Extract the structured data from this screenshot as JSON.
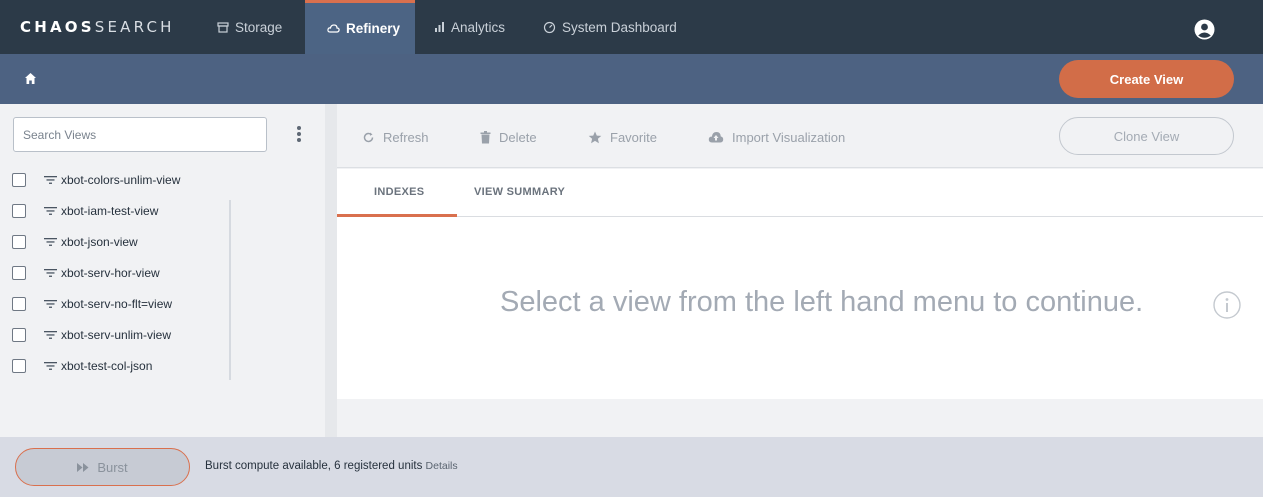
{
  "app": {
    "logo_bold": "CHAOS",
    "logo_light": "SEARCH"
  },
  "nav": {
    "tabs": [
      {
        "label": "Storage",
        "icon": "storage-icon"
      },
      {
        "label": "Refinery",
        "icon": "refinery-icon",
        "active": true
      },
      {
        "label": "Analytics",
        "icon": "analytics-icon"
      },
      {
        "label": "System Dashboard",
        "icon": "dashboard-icon"
      }
    ],
    "user_icon": "user-circle-icon"
  },
  "subbar": {
    "home_icon": "home-icon",
    "create_label": "Create View"
  },
  "sidebar": {
    "search_placeholder": "Search Views",
    "views": [
      "xbot-colors-unlim-view",
      "xbot-iam-test-view",
      "xbot-json-view",
      "xbot-serv-hor-view",
      "xbot-serv-no-flt=view",
      "xbot-serv-unlim-view",
      "xbot-test-col-json"
    ]
  },
  "toolbar": {
    "refresh": "Refresh",
    "delete": "Delete",
    "favorite": "Favorite",
    "import": "Import Visualization",
    "clone": "Clone View"
  },
  "tabs": {
    "indexes": "INDEXES",
    "summary": "VIEW SUMMARY"
  },
  "main": {
    "empty_message": "Select a view from the left hand menu to continue."
  },
  "footer": {
    "burst_label": "Burst",
    "status": "Burst compute available, 6 registered units",
    "details": "Details"
  },
  "colors": {
    "nav_bg": "#2c3a48",
    "subbar_bg": "#4d6282",
    "accent": "#d26d48"
  }
}
